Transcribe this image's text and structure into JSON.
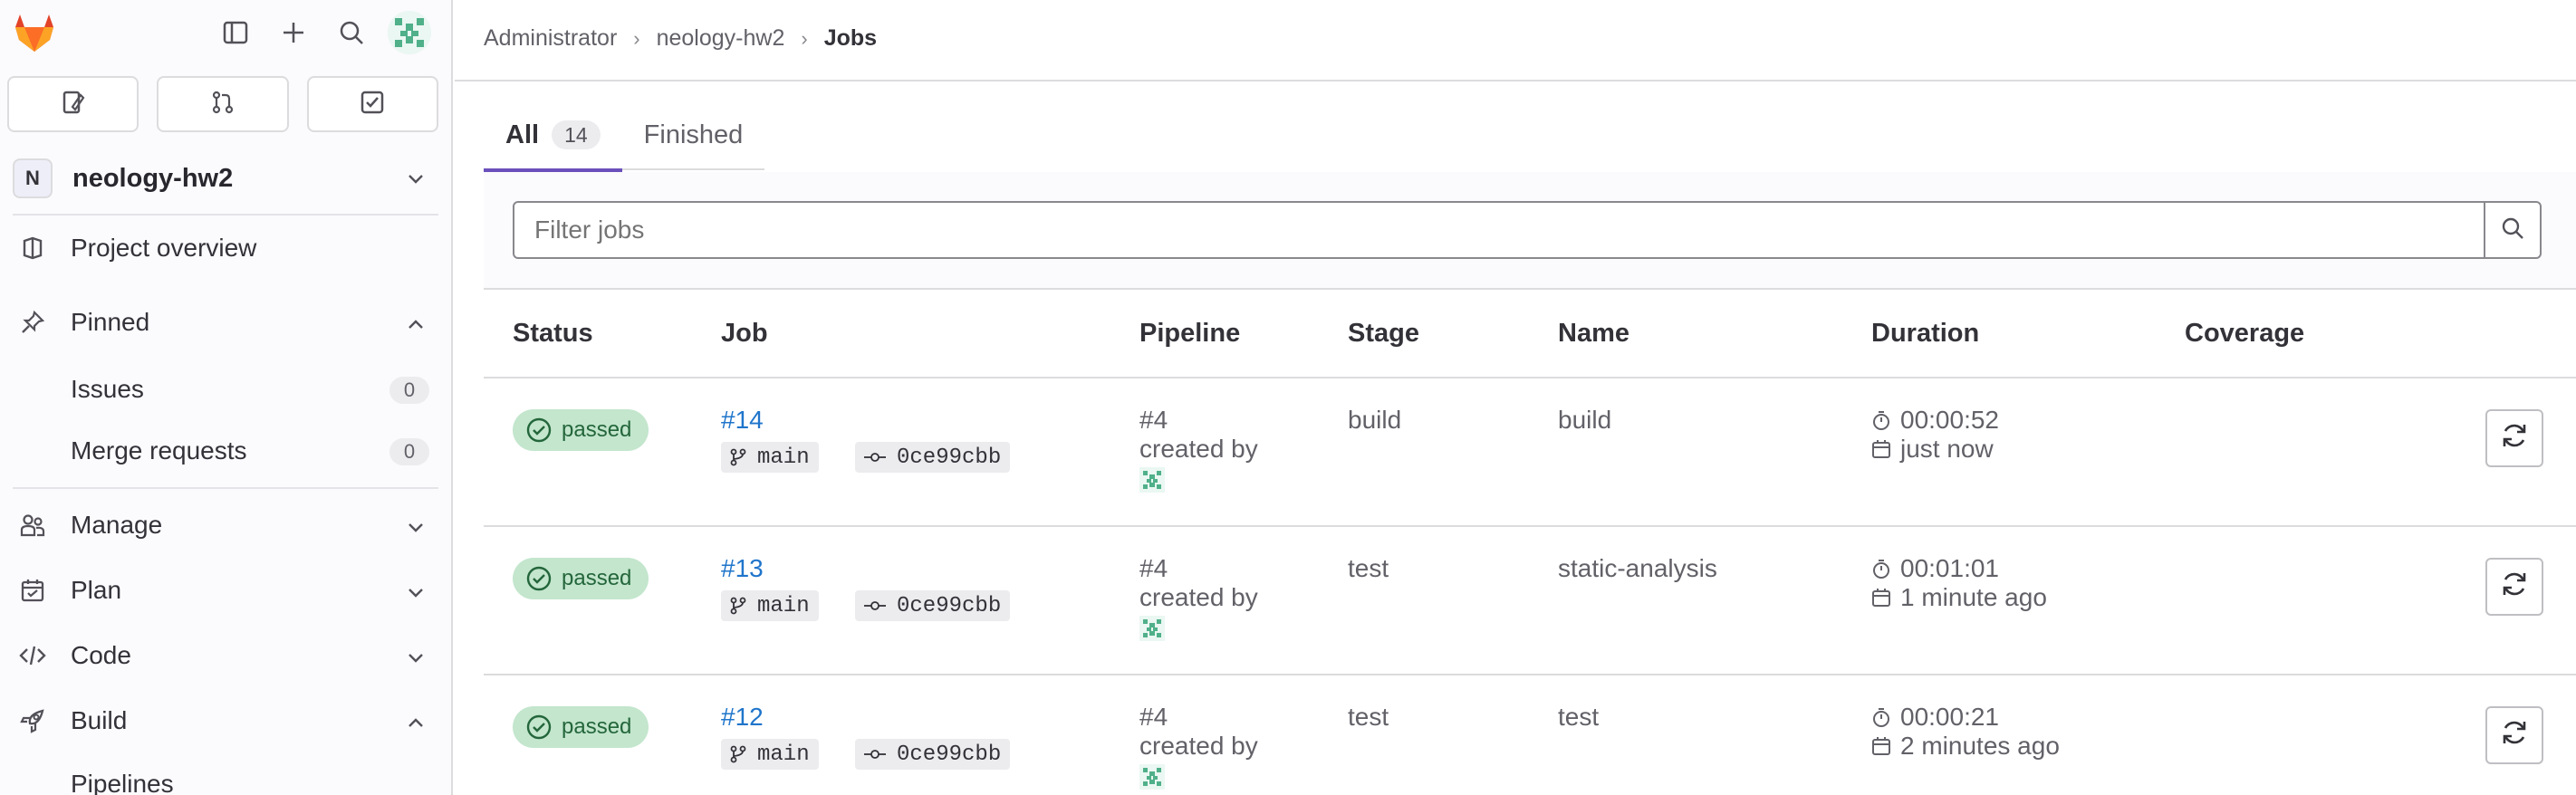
{
  "sidebar": {
    "project": {
      "initial": "N",
      "name": "neology-hw2"
    },
    "project_overview": "Project overview",
    "pinned": {
      "label": "Pinned",
      "items": [
        {
          "label": "Issues",
          "count": "0"
        },
        {
          "label": "Merge requests",
          "count": "0"
        }
      ]
    },
    "sections": [
      {
        "label": "Manage"
      },
      {
        "label": "Plan"
      },
      {
        "label": "Code"
      },
      {
        "label": "Build"
      }
    ],
    "build_sub": [
      {
        "label": "Pipelines"
      }
    ]
  },
  "breadcrumb": [
    "Administrator",
    "neology-hw2",
    "Jobs"
  ],
  "tabs": [
    {
      "label": "All",
      "count": "14"
    },
    {
      "label": "Finished"
    }
  ],
  "filter": {
    "placeholder": "Filter jobs"
  },
  "table": {
    "headers": [
      "Status",
      "Job",
      "Pipeline",
      "Stage",
      "Name",
      "Duration",
      "Coverage"
    ],
    "rows": [
      {
        "status": "passed",
        "job": "#14",
        "branch": "main",
        "commit": "0ce99cbb",
        "pipeline": "#4",
        "created_by": "created by",
        "stage": "build",
        "name": "build",
        "duration": "00:00:52",
        "finished": "just now"
      },
      {
        "status": "passed",
        "job": "#13",
        "branch": "main",
        "commit": "0ce99cbb",
        "pipeline": "#4",
        "created_by": "created by",
        "stage": "test",
        "name": "static-analysis",
        "duration": "00:01:01",
        "finished": "1 minute ago"
      },
      {
        "status": "passed",
        "job": "#12",
        "branch": "main",
        "commit": "0ce99cbb",
        "pipeline": "#4",
        "created_by": "created by",
        "stage": "test",
        "name": "test",
        "duration": "00:00:21",
        "finished": "2 minutes ago"
      }
    ]
  },
  "colors": {
    "accent": "#6b4fbb",
    "link": "#1f75cb",
    "success_bg": "#c3e6cd",
    "success_fg": "#24663b"
  }
}
